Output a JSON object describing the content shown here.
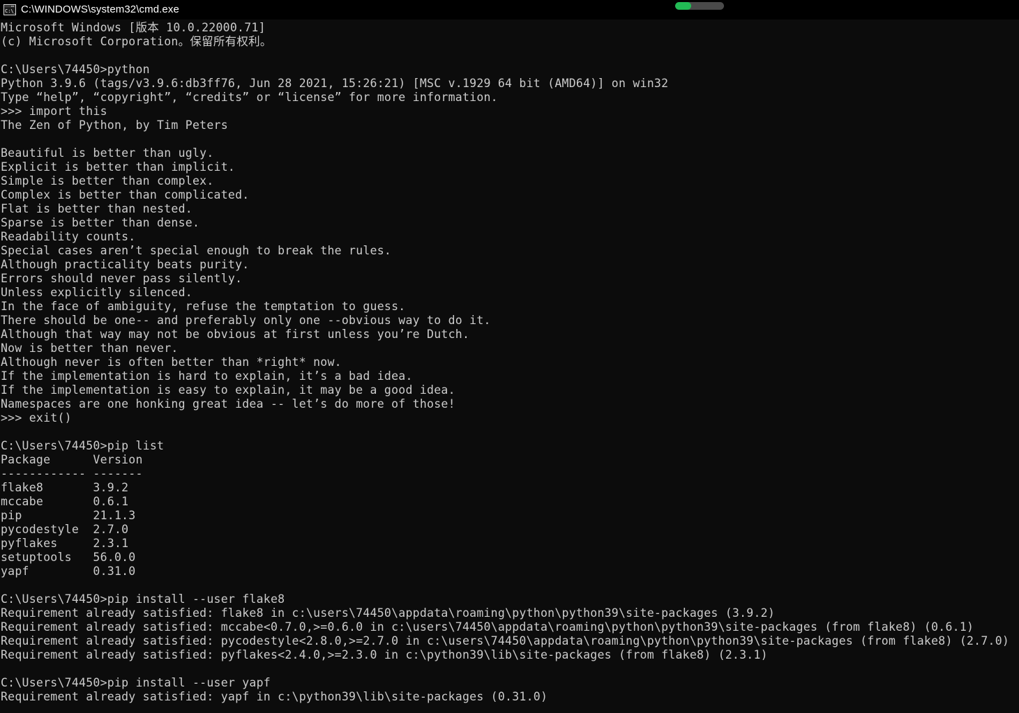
{
  "window": {
    "title": "C:\\WINDOWS\\system32\\cmd.exe",
    "icon": "cmd-console-icon",
    "titlebar_bg": "#000000",
    "console_bg": "#0c0c0c",
    "text_color": "#cccccc"
  },
  "progress": {
    "name": "progress-bar",
    "percent": 33,
    "fill_color": "#22bb55",
    "track_color": "#4a4a4a"
  },
  "console": {
    "prompt": "C:\\Users\\74450>",
    "lines": [
      "Microsoft Windows [版本 10.0.22000.71]",
      "(c) Microsoft Corporation。保留所有权利。",
      "",
      "C:\\Users\\74450>python",
      "Python 3.9.6 (tags/v3.9.6:db3ff76, Jun 28 2021, 15:26:21) [MSC v.1929 64 bit (AMD64)] on win32",
      "Type “help”, “copyright”, “credits” or “license” for more information.",
      ">>> import this",
      "The Zen of Python, by Tim Peters",
      "",
      "Beautiful is better than ugly.",
      "Explicit is better than implicit.",
      "Simple is better than complex.",
      "Complex is better than complicated.",
      "Flat is better than nested.",
      "Sparse is better than dense.",
      "Readability counts.",
      "Special cases aren’t special enough to break the rules.",
      "Although practicality beats purity.",
      "Errors should never pass silently.",
      "Unless explicitly silenced.",
      "In the face of ambiguity, refuse the temptation to guess.",
      "There should be one-- and preferably only one --obvious way to do it.",
      "Although that way may not be obvious at first unless you’re Dutch.",
      "Now is better than never.",
      "Although never is often better than *right* now.",
      "If the implementation is hard to explain, it’s a bad idea.",
      "If the implementation is easy to explain, it may be a good idea.",
      "Namespaces are one honking great idea -- let’s do more of those!",
      ">>> exit()",
      "",
      "C:\\Users\\74450>pip list",
      "Package      Version",
      "------------ -------",
      "flake8       3.9.2",
      "mccabe       0.6.1",
      "pip          21.1.3",
      "pycodestyle  2.7.0",
      "pyflakes     2.3.1",
      "setuptools   56.0.0",
      "yapf         0.31.0",
      "",
      "C:\\Users\\74450>pip install --user flake8",
      "Requirement already satisfied: flake8 in c:\\users\\74450\\appdata\\roaming\\python\\python39\\site-packages (3.9.2)",
      "Requirement already satisfied: mccabe<0.7.0,>=0.6.0 in c:\\users\\74450\\appdata\\roaming\\python\\python39\\site-packages (from flake8) (0.6.1)",
      "Requirement already satisfied: pycodestyle<2.8.0,>=2.7.0 in c:\\users\\74450\\appdata\\roaming\\python\\python39\\site-packages (from flake8) (2.7.0)",
      "Requirement already satisfied: pyflakes<2.4.0,>=2.3.0 in c:\\python39\\lib\\site-packages (from flake8) (2.3.1)",
      "",
      "C:\\Users\\74450>pip install --user yapf",
      "Requirement already satisfied: yapf in c:\\python39\\lib\\site-packages (0.31.0)"
    ],
    "package_table": {
      "headers": [
        "Package",
        "Version"
      ],
      "rows": [
        [
          "flake8",
          "3.9.2"
        ],
        [
          "mccabe",
          "0.6.1"
        ],
        [
          "pip",
          "21.1.3"
        ],
        [
          "pycodestyle",
          "2.7.0"
        ],
        [
          "pyflakes",
          "2.3.1"
        ],
        [
          "setuptools",
          "56.0.0"
        ],
        [
          "yapf",
          "0.31.0"
        ]
      ]
    }
  }
}
